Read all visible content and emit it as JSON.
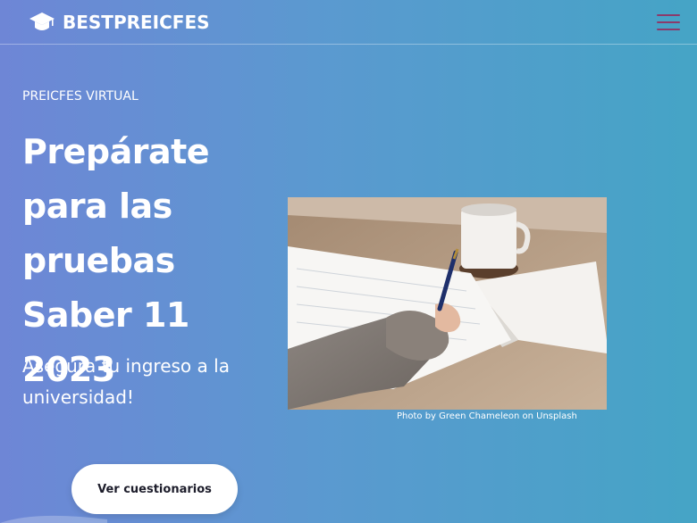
{
  "nav": {
    "brand": "BESTPREICFES",
    "brand_icon": "graduation-cap-icon",
    "menu_icon": "hamburger-menu-icon",
    "menu_color": "#8b3a6b"
  },
  "hero": {
    "eyebrow": "PREICFES VIRTUAL",
    "title_lines": [
      "Prepárate",
      "para las",
      "pruebas",
      "Saber 11 2023"
    ],
    "subtitle": "Asegura tu ingreso a la universidad!",
    "image_credit": "Photo by Green Chameleon on Unsplash",
    "cta_label": "Ver cuestionarios"
  },
  "colors": {
    "gradient_start": "#6e86d6",
    "gradient_end": "#45a4c6",
    "button_bg": "#ffffff",
    "button_text": "#1d1d2b"
  }
}
